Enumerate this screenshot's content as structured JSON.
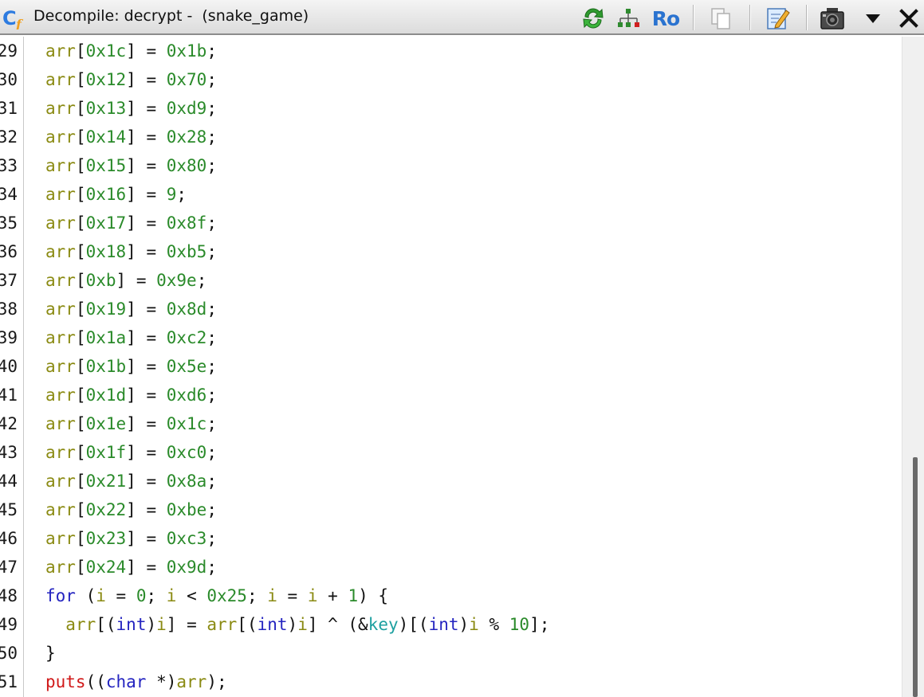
{
  "window": {
    "title": "Decompile: decrypt -  (snake_game)",
    "icons": [
      "decompiler-app-icon",
      "refresh-icon",
      "function-graph-icon",
      "read-only-icon",
      "copy-icon",
      "edit-icon",
      "snapshot-icon",
      "dropdown-icon",
      "close-icon"
    ],
    "read_only_label": "Ro"
  },
  "colors": {
    "variable": "#8a8a12",
    "number": "#2a8a2a",
    "keyword": "#2424c0",
    "function": "#d01818",
    "global": "#1ea0a0",
    "text": "#111111"
  },
  "code_lines": [
    {
      "num": "29",
      "tokens": [
        [
          "v",
          "arr"
        ],
        [
          "p",
          "["
        ],
        [
          "n",
          "0x1c"
        ],
        [
          "p",
          "] = "
        ],
        [
          "n",
          "0x1b"
        ],
        [
          "p",
          ";"
        ]
      ]
    },
    {
      "num": "30",
      "tokens": [
        [
          "v",
          "arr"
        ],
        [
          "p",
          "["
        ],
        [
          "n",
          "0x12"
        ],
        [
          "p",
          "] = "
        ],
        [
          "n",
          "0x70"
        ],
        [
          "p",
          ";"
        ]
      ]
    },
    {
      "num": "31",
      "tokens": [
        [
          "v",
          "arr"
        ],
        [
          "p",
          "["
        ],
        [
          "n",
          "0x13"
        ],
        [
          "p",
          "] = "
        ],
        [
          "n",
          "0xd9"
        ],
        [
          "p",
          ";"
        ]
      ]
    },
    {
      "num": "32",
      "tokens": [
        [
          "v",
          "arr"
        ],
        [
          "p",
          "["
        ],
        [
          "n",
          "0x14"
        ],
        [
          "p",
          "] = "
        ],
        [
          "n",
          "0x28"
        ],
        [
          "p",
          ";"
        ]
      ]
    },
    {
      "num": "33",
      "tokens": [
        [
          "v",
          "arr"
        ],
        [
          "p",
          "["
        ],
        [
          "n",
          "0x15"
        ],
        [
          "p",
          "] = "
        ],
        [
          "n",
          "0x80"
        ],
        [
          "p",
          ";"
        ]
      ]
    },
    {
      "num": "34",
      "tokens": [
        [
          "v",
          "arr"
        ],
        [
          "p",
          "["
        ],
        [
          "n",
          "0x16"
        ],
        [
          "p",
          "] = "
        ],
        [
          "n",
          "9"
        ],
        [
          "p",
          ";"
        ]
      ]
    },
    {
      "num": "35",
      "tokens": [
        [
          "v",
          "arr"
        ],
        [
          "p",
          "["
        ],
        [
          "n",
          "0x17"
        ],
        [
          "p",
          "] = "
        ],
        [
          "n",
          "0x8f"
        ],
        [
          "p",
          ";"
        ]
      ]
    },
    {
      "num": "36",
      "tokens": [
        [
          "v",
          "arr"
        ],
        [
          "p",
          "["
        ],
        [
          "n",
          "0x18"
        ],
        [
          "p",
          "] = "
        ],
        [
          "n",
          "0xb5"
        ],
        [
          "p",
          ";"
        ]
      ]
    },
    {
      "num": "37",
      "tokens": [
        [
          "v",
          "arr"
        ],
        [
          "p",
          "["
        ],
        [
          "n",
          "0xb"
        ],
        [
          "p",
          "] = "
        ],
        [
          "n",
          "0x9e"
        ],
        [
          "p",
          ";"
        ]
      ]
    },
    {
      "num": "38",
      "tokens": [
        [
          "v",
          "arr"
        ],
        [
          "p",
          "["
        ],
        [
          "n",
          "0x19"
        ],
        [
          "p",
          "] = "
        ],
        [
          "n",
          "0x8d"
        ],
        [
          "p",
          ";"
        ]
      ]
    },
    {
      "num": "39",
      "tokens": [
        [
          "v",
          "arr"
        ],
        [
          "p",
          "["
        ],
        [
          "n",
          "0x1a"
        ],
        [
          "p",
          "] = "
        ],
        [
          "n",
          "0xc2"
        ],
        [
          "p",
          ";"
        ]
      ]
    },
    {
      "num": "40",
      "tokens": [
        [
          "v",
          "arr"
        ],
        [
          "p",
          "["
        ],
        [
          "n",
          "0x1b"
        ],
        [
          "p",
          "] = "
        ],
        [
          "n",
          "0x5e"
        ],
        [
          "p",
          ";"
        ]
      ]
    },
    {
      "num": "41",
      "tokens": [
        [
          "v",
          "arr"
        ],
        [
          "p",
          "["
        ],
        [
          "n",
          "0x1d"
        ],
        [
          "p",
          "] = "
        ],
        [
          "n",
          "0xd6"
        ],
        [
          "p",
          ";"
        ]
      ]
    },
    {
      "num": "42",
      "tokens": [
        [
          "v",
          "arr"
        ],
        [
          "p",
          "["
        ],
        [
          "n",
          "0x1e"
        ],
        [
          "p",
          "] = "
        ],
        [
          "n",
          "0x1c"
        ],
        [
          "p",
          ";"
        ]
      ]
    },
    {
      "num": "43",
      "tokens": [
        [
          "v",
          "arr"
        ],
        [
          "p",
          "["
        ],
        [
          "n",
          "0x1f"
        ],
        [
          "p",
          "] = "
        ],
        [
          "n",
          "0xc0"
        ],
        [
          "p",
          ";"
        ]
      ]
    },
    {
      "num": "44",
      "tokens": [
        [
          "v",
          "arr"
        ],
        [
          "p",
          "["
        ],
        [
          "n",
          "0x21"
        ],
        [
          "p",
          "] = "
        ],
        [
          "n",
          "0x8a"
        ],
        [
          "p",
          ";"
        ]
      ]
    },
    {
      "num": "45",
      "tokens": [
        [
          "v",
          "arr"
        ],
        [
          "p",
          "["
        ],
        [
          "n",
          "0x22"
        ],
        [
          "p",
          "] = "
        ],
        [
          "n",
          "0xbe"
        ],
        [
          "p",
          ";"
        ]
      ]
    },
    {
      "num": "46",
      "tokens": [
        [
          "v",
          "arr"
        ],
        [
          "p",
          "["
        ],
        [
          "n",
          "0x23"
        ],
        [
          "p",
          "] = "
        ],
        [
          "n",
          "0xc3"
        ],
        [
          "p",
          ";"
        ]
      ]
    },
    {
      "num": "47",
      "tokens": [
        [
          "v",
          "arr"
        ],
        [
          "p",
          "["
        ],
        [
          "n",
          "0x24"
        ],
        [
          "p",
          "] = "
        ],
        [
          "n",
          "0x9d"
        ],
        [
          "p",
          ";"
        ]
      ]
    },
    {
      "num": "48",
      "tokens": [
        [
          "k",
          "for"
        ],
        [
          "p",
          " ("
        ],
        [
          "v",
          "i"
        ],
        [
          "p",
          " = "
        ],
        [
          "n",
          "0"
        ],
        [
          "p",
          "; "
        ],
        [
          "v",
          "i"
        ],
        [
          "p",
          " < "
        ],
        [
          "n",
          "0x25"
        ],
        [
          "p",
          "; "
        ],
        [
          "v",
          "i"
        ],
        [
          "p",
          " = "
        ],
        [
          "v",
          "i"
        ],
        [
          "p",
          " + "
        ],
        [
          "n",
          "1"
        ],
        [
          "p",
          ") {"
        ]
      ]
    },
    {
      "num": "49",
      "tokens": [
        [
          "p",
          "  "
        ],
        [
          "v",
          "arr"
        ],
        [
          "p",
          "[("
        ],
        [
          "k",
          "int"
        ],
        [
          "p",
          ")"
        ],
        [
          "v",
          "i"
        ],
        [
          "p",
          "] = "
        ],
        [
          "v",
          "arr"
        ],
        [
          "p",
          "[("
        ],
        [
          "k",
          "int"
        ],
        [
          "p",
          ")"
        ],
        [
          "v",
          "i"
        ],
        [
          "p",
          "] ^ (&"
        ],
        [
          "g",
          "key"
        ],
        [
          "p",
          ")[("
        ],
        [
          "k",
          "int"
        ],
        [
          "p",
          ")"
        ],
        [
          "v",
          "i"
        ],
        [
          "p",
          " % "
        ],
        [
          "n",
          "10"
        ],
        [
          "p",
          "];"
        ]
      ]
    },
    {
      "num": "50",
      "tokens": [
        [
          "p",
          "}"
        ]
      ]
    },
    {
      "num": "51",
      "tokens": [
        [
          "f",
          "puts"
        ],
        [
          "p",
          "(("
        ],
        [
          "k",
          "char"
        ],
        [
          "p",
          " *)"
        ],
        [
          "v",
          "arr"
        ],
        [
          "p",
          ");"
        ]
      ]
    }
  ]
}
